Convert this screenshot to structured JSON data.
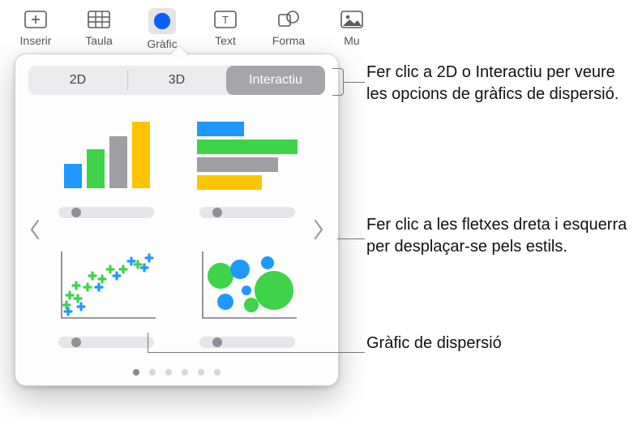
{
  "toolbar": {
    "items": [
      {
        "label": "Inserir",
        "icon": "insert-icon"
      },
      {
        "label": "Taula",
        "icon": "table-icon"
      },
      {
        "label": "Gràfic",
        "icon": "chart-icon",
        "active": true
      },
      {
        "label": "Text",
        "icon": "text-icon"
      },
      {
        "label": "Forma",
        "icon": "shape-icon"
      },
      {
        "label": "Mu",
        "icon": "media-icon"
      }
    ]
  },
  "popover": {
    "segments": {
      "d2": "2D",
      "d3": "3D",
      "interactive": "Interactiu",
      "selected": "interactive"
    },
    "thumbs": [
      {
        "name": "bar-chart-thumb",
        "kind": "bar"
      },
      {
        "name": "hbar-chart-thumb",
        "kind": "hbar"
      },
      {
        "name": "scatter-chart-thumb",
        "kind": "scatter"
      },
      {
        "name": "bubble-chart-thumb",
        "kind": "bubble"
      }
    ],
    "page_count": 6,
    "page_active_index": 0
  },
  "callouts": {
    "c1": "Fer clic a 2D o Interactiu per veure les opcions de gràfics de dispersió.",
    "c2": "Fer clic a les fletxes dreta i esquerra per desplaçar-se pels estils.",
    "c3": "Gràfic de dispersió"
  }
}
